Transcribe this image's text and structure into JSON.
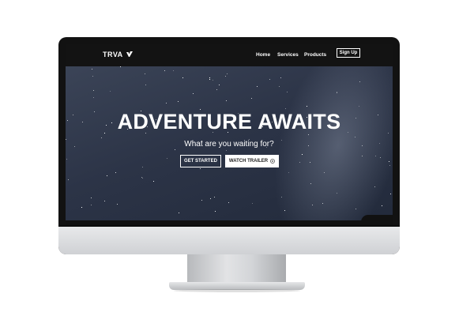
{
  "nav": {
    "brand": "TRVA",
    "links": [
      "Home",
      "Services",
      "Products"
    ],
    "signup_label": "Sign Up"
  },
  "hero": {
    "title": "ADVENTURE AWAITS",
    "subtitle": "What are you waiting for?",
    "primary_button": "GET STARTED",
    "secondary_button": "WATCH TRAILER",
    "secondary_icon": "play-circle-icon"
  },
  "colors": {
    "nav_bg": "#131313",
    "hero_bg": "#2c3447",
    "text": "#ffffff",
    "button_solid_bg": "#ffffff"
  }
}
